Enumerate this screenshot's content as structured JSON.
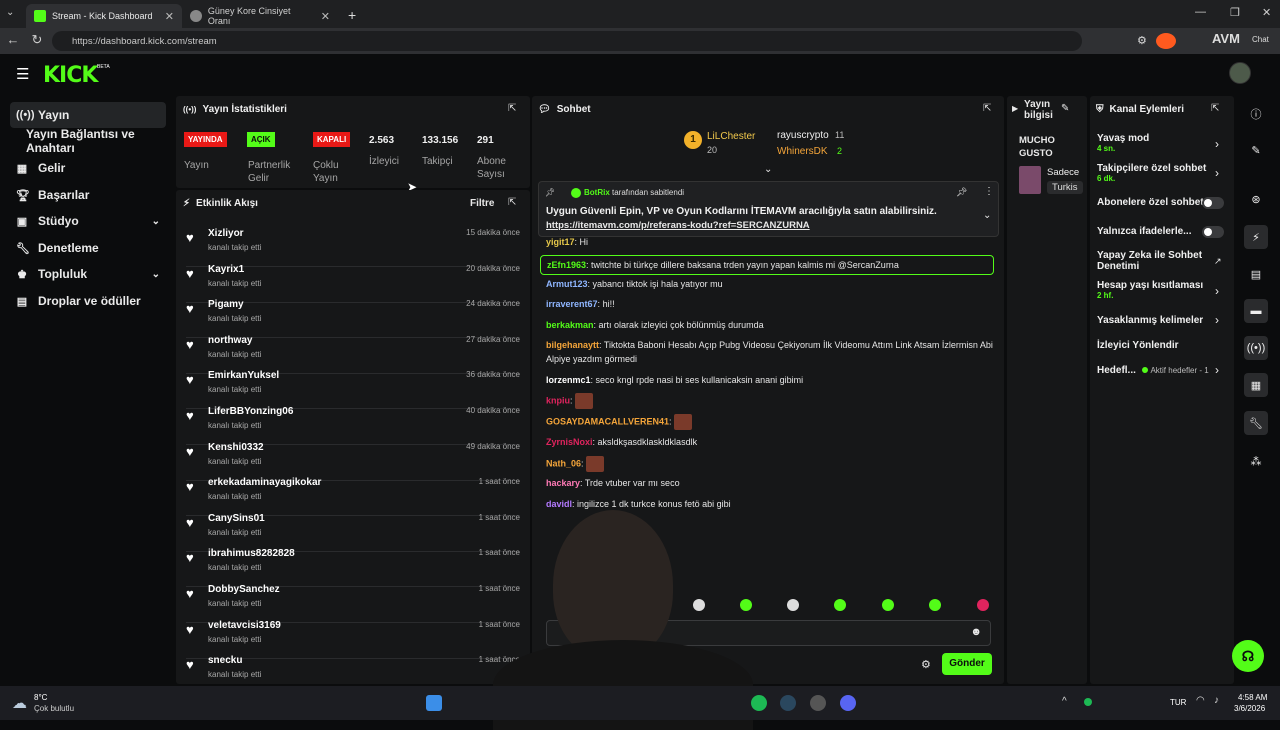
{
  "browser": {
    "tabs": [
      {
        "title": "Stream - Kick Dashboard",
        "active": true
      },
      {
        "title": "Güney Kore Cinsiyet Oranı",
        "active": false
      }
    ],
    "url": "https://dashboard.kick.com/stream",
    "new_tab": "+",
    "extension_label": "AVM",
    "chat_label": "Chat"
  },
  "header": {
    "logo": "KICK",
    "beta": "BETA"
  },
  "sidebar": {
    "items": [
      {
        "label": "Yayın",
        "icon": "broadcast-icon",
        "active": true
      },
      {
        "label": "Yayın Bağlantısı ve Anahtarı",
        "icon": "",
        "active": false
      },
      {
        "label": "Gelir",
        "icon": "revenue-icon",
        "active": false
      },
      {
        "label": "Başarılar",
        "icon": "trophy-icon",
        "active": false
      },
      {
        "label": "Stüdyo",
        "icon": "studio-icon",
        "active": false,
        "chevron": true
      },
      {
        "label": "Denetleme",
        "icon": "wrench-icon",
        "active": false
      },
      {
        "label": "Topluluk",
        "icon": "community-icon",
        "active": false,
        "chevron": true
      },
      {
        "label": "Droplar ve ödüller",
        "icon": "gift-icon",
        "active": false
      }
    ]
  },
  "stats": {
    "title": "Yayın İstatistikleri",
    "items": [
      {
        "badge": "YAYINDA",
        "badge_color": "#e91916",
        "label": "Yayın"
      },
      {
        "badge": "AÇIK",
        "badge_color": "#53fc18",
        "label": "Partnerlik Gelir"
      },
      {
        "badge": "KAPALI",
        "badge_color": "#e91916",
        "label": "Çoklu Yayın"
      },
      {
        "value": "2.563",
        "label": "İzleyici"
      },
      {
        "value": "133.156",
        "label": "Takipçi"
      },
      {
        "value": "291",
        "label": "Abone Sayısı"
      }
    ]
  },
  "activity": {
    "title": "Etkinlik Akışı",
    "filter": "Filtre",
    "items": [
      {
        "name": "Xizliyor",
        "sub": "kanalı takip etti",
        "time": "15 dakika önce"
      },
      {
        "name": "Kayrix1",
        "sub": "kanalı takip etti",
        "time": "20 dakika önce"
      },
      {
        "name": "Pigamy",
        "sub": "kanalı takip etti",
        "time": "24 dakika önce"
      },
      {
        "name": "northway",
        "sub": "kanalı takip etti",
        "time": "27 dakika önce"
      },
      {
        "name": "EmirkanYuksel",
        "sub": "kanalı takip etti",
        "time": "36 dakika önce"
      },
      {
        "name": "LiferBBYonzing06",
        "sub": "kanalı takip etti",
        "time": "40 dakika önce"
      },
      {
        "name": "Kenshi0332",
        "sub": "kanalı takip etti",
        "time": "49 dakika önce"
      },
      {
        "name": "erkekadaminayagikokar",
        "sub": "kanalı takip etti",
        "time": "1 saat önce"
      },
      {
        "name": "CanySins01",
        "sub": "kanalı takip etti",
        "time": "1 saat önce"
      },
      {
        "name": "ibrahimus8282828",
        "sub": "kanalı takip etti",
        "time": "1 saat önce"
      },
      {
        "name": "DobbySanchez",
        "sub": "kanalı takip etti",
        "time": "1 saat önce"
      },
      {
        "name": "veletavcisi3169",
        "sub": "kanalı takip etti",
        "time": "1 saat önce"
      },
      {
        "name": "snecku",
        "sub": "kanalı takip etti",
        "time": "1 saat önce"
      }
    ]
  },
  "chat": {
    "title": "Sohbet",
    "top_gifters": [
      {
        "rank": "1",
        "name": "LiLChester",
        "count": "20"
      },
      {
        "name": "rayuscrypto",
        "count": "11"
      },
      {
        "name": "WhinersDK",
        "count": "2"
      }
    ],
    "pinned": {
      "by_user": "BotRix",
      "by_text": "tarafından sabitlendi",
      "message": "Uygun Güvenli Epin, VP ve Oyun Kodlarını İTEMAVM aracılığıyla satın alabilirsiniz.",
      "link": "https://itemavm.com/p/referans-kodu?ref=SERCANZURNA"
    },
    "messages": [
      {
        "user": "yigit17",
        "color": "#e6c84a",
        "text": "Hi",
        "emote": false
      },
      {
        "user": "zEfn1963",
        "color": "#53fc18",
        "text": "twitchte bi türkçe dillere baksana trden yayın yapan kalmis mi @SercanZurna",
        "highlight": true
      },
      {
        "user": "Armut123",
        "color": "#8fb6ff",
        "text": "yabancı tiktok işi hala yatıyor mu"
      },
      {
        "user": "irraverent67",
        "color": "#8fb6ff",
        "text": "hi!!"
      },
      {
        "user": "berkakman",
        "color": "#53fc18",
        "text": "artı olarak izleyici çok bölünmüş durumda"
      },
      {
        "user": "bilgehanaytt",
        "color": "#f4a53a",
        "text": "Tiktokta Baboni Hesabı Açıp Pubg Videosu Çekiyorum İlk Videomu Attım Link Atsam İzlermisn Abi Alpiye yazdım görmedi"
      },
      {
        "user": "lorzenmc1",
        "color": "#ffffff",
        "text": "seco kngl rpde nasi bi ses kullanicaksin anani gibimi"
      },
      {
        "user": "knpiu",
        "color": "#e0245e",
        "text": "",
        "emote": true
      },
      {
        "user": "GOSAYDAMACALLVEREN41",
        "color": "#f4a53a",
        "text": "",
        "emote": true
      },
      {
        "user": "ZyrnisNoxi",
        "color": "#e0245e",
        "text": "aksldkşasdklaskldklasdlk"
      },
      {
        "user": "Nath_06",
        "color": "#f4a53a",
        "text": "",
        "emote": true
      },
      {
        "user": "hackary",
        "color": "#ff7ab6",
        "text": "Trde vtuber var mı seco"
      },
      {
        "user": "davidl",
        "color": "#b37aff",
        "text": "ingilizce 1 dk turkce konus fetö abi gibi"
      }
    ],
    "send_button": "Gönder"
  },
  "stream_info": {
    "title": "Yayın bilgisi",
    "stream_title": "MUCHO GUSTO",
    "category": "Sadece",
    "tag": "Turkis"
  },
  "channel_actions": {
    "title": "Kanal Eylemleri",
    "items": [
      {
        "label": "Yavaş mod",
        "sub": "4 sn.",
        "control": "chevron"
      },
      {
        "label": "Takipçilere özel sohbet",
        "sub": "6 dk.",
        "control": "chevron"
      },
      {
        "label": "Abonelere özel sohbet",
        "sub": "",
        "control": "toggle"
      },
      {
        "label": "Yalnızca ifadelerle...",
        "sub": "",
        "control": "toggle"
      },
      {
        "label": "Yapay Zeka ile Sohbet Denetimi",
        "sub": "",
        "control": "external"
      },
      {
        "label": "Hesap yaşı kısıtlaması",
        "sub": "2 hf.",
        "control": "chevron"
      },
      {
        "label": "Yasaklanmış kelimeler",
        "sub": "",
        "control": "chevron"
      },
      {
        "label": "İzleyici Yönlendir",
        "sub": "",
        "control": "none"
      },
      {
        "label": "Hedefl...",
        "sub": "Aktif hedefler - 1",
        "control": "chevron"
      }
    ]
  },
  "taskbar": {
    "weather_temp": "8°C",
    "weather_desc": "Çok bulutlu",
    "language": "TUR",
    "time": "4:58 AM",
    "date": "3/6/2026"
  },
  "colors": {
    "accent": "#53fc18",
    "live_red": "#e91916"
  }
}
